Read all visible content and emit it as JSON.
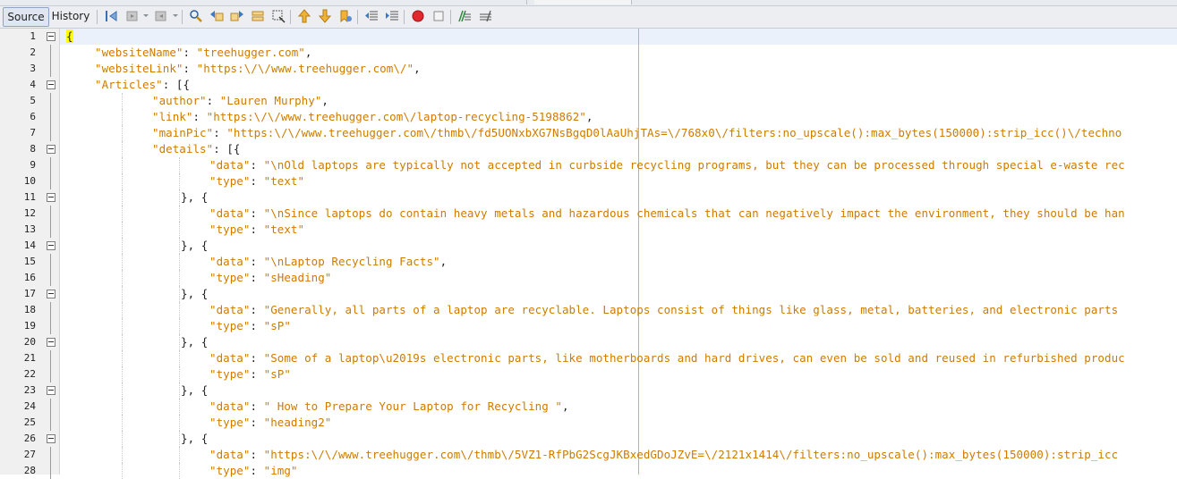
{
  "toolbar": {
    "source_label": "Source",
    "history_label": "History"
  },
  "editor": {
    "lines": [
      {
        "num": "1",
        "ind": 0,
        "segs": [
          {
            "t": "{",
            "c": "brace-hl"
          }
        ]
      },
      {
        "num": "2",
        "ind": 4,
        "segs": [
          {
            "t": "\"websiteName\"",
            "c": "k"
          },
          {
            "t": ": ",
            "c": "p"
          },
          {
            "t": "\"treehugger.com\"",
            "c": "k"
          },
          {
            "t": ",",
            "c": "p"
          }
        ]
      },
      {
        "num": "3",
        "ind": 4,
        "segs": [
          {
            "t": "\"websiteLink\"",
            "c": "k"
          },
          {
            "t": ": ",
            "c": "p"
          },
          {
            "t": "\"https:\\/\\/www.treehugger.com\\/\"",
            "c": "k"
          },
          {
            "t": ",",
            "c": "p"
          }
        ]
      },
      {
        "num": "4",
        "ind": 4,
        "segs": [
          {
            "t": "\"Articles\"",
            "c": "k"
          },
          {
            "t": ": [{",
            "c": "p"
          }
        ]
      },
      {
        "num": "5",
        "ind": 12,
        "segs": [
          {
            "t": "\"author\"",
            "c": "k"
          },
          {
            "t": ": ",
            "c": "p"
          },
          {
            "t": "\"Lauren Murphy\"",
            "c": "k"
          },
          {
            "t": ",",
            "c": "p"
          }
        ]
      },
      {
        "num": "6",
        "ind": 12,
        "segs": [
          {
            "t": "\"link\"",
            "c": "k"
          },
          {
            "t": ": ",
            "c": "p"
          },
          {
            "t": "\"https:\\/\\/www.treehugger.com\\/laptop-recycling-5198862\"",
            "c": "k"
          },
          {
            "t": ",",
            "c": "p"
          }
        ]
      },
      {
        "num": "7",
        "ind": 12,
        "segs": [
          {
            "t": "\"mainPic\"",
            "c": "k"
          },
          {
            "t": ": ",
            "c": "p"
          },
          {
            "t": "\"https:\\/\\/www.treehugger.com\\/thmb\\/fd5UONxbXG7NsBgqD0lAaUhjTAs=\\/768x0\\/filters:no_upscale():max_bytes(150000):strip_icc()\\/techno",
            "c": "k"
          }
        ]
      },
      {
        "num": "8",
        "ind": 12,
        "segs": [
          {
            "t": "\"details\"",
            "c": "k"
          },
          {
            "t": ": [{",
            "c": "p"
          }
        ]
      },
      {
        "num": "9",
        "ind": 20,
        "segs": [
          {
            "t": "\"data\"",
            "c": "k"
          },
          {
            "t": ": ",
            "c": "p"
          },
          {
            "t": "\"\\nOld laptops are typically not accepted in curbside recycling programs, but they can be processed through special e-waste rec",
            "c": "k"
          }
        ]
      },
      {
        "num": "10",
        "ind": 20,
        "segs": [
          {
            "t": "\"type\"",
            "c": "k"
          },
          {
            "t": ": ",
            "c": "p"
          },
          {
            "t": "\"text\"",
            "c": "k"
          }
        ]
      },
      {
        "num": "11",
        "ind": 16,
        "segs": [
          {
            "t": "}, {",
            "c": "p"
          }
        ]
      },
      {
        "num": "12",
        "ind": 20,
        "segs": [
          {
            "t": "\"data\"",
            "c": "k"
          },
          {
            "t": ": ",
            "c": "p"
          },
          {
            "t": "\"\\nSince laptops do contain heavy metals and hazardous chemicals that can negatively impact the environment, they should be han",
            "c": "k"
          }
        ]
      },
      {
        "num": "13",
        "ind": 20,
        "segs": [
          {
            "t": "\"type\"",
            "c": "k"
          },
          {
            "t": ": ",
            "c": "p"
          },
          {
            "t": "\"text\"",
            "c": "k"
          }
        ]
      },
      {
        "num": "14",
        "ind": 16,
        "segs": [
          {
            "t": "}, {",
            "c": "p"
          }
        ]
      },
      {
        "num": "15",
        "ind": 20,
        "segs": [
          {
            "t": "\"data\"",
            "c": "k"
          },
          {
            "t": ": ",
            "c": "p"
          },
          {
            "t": "\"\\nLaptop Recycling Facts\"",
            "c": "k"
          },
          {
            "t": ",",
            "c": "p"
          }
        ]
      },
      {
        "num": "16",
        "ind": 20,
        "segs": [
          {
            "t": "\"type\"",
            "c": "k"
          },
          {
            "t": ": ",
            "c": "p"
          },
          {
            "t": "\"sHeading\"",
            "c": "k"
          }
        ]
      },
      {
        "num": "17",
        "ind": 16,
        "segs": [
          {
            "t": "}, {",
            "c": "p"
          }
        ]
      },
      {
        "num": "18",
        "ind": 20,
        "segs": [
          {
            "t": "\"data\"",
            "c": "k"
          },
          {
            "t": ": ",
            "c": "p"
          },
          {
            "t": "\"Generally, all parts of a laptop are recyclable. Laptops consist of things like glass, metal, batteries, and electronic parts",
            "c": "k"
          }
        ]
      },
      {
        "num": "19",
        "ind": 20,
        "segs": [
          {
            "t": "\"type\"",
            "c": "k"
          },
          {
            "t": ": ",
            "c": "p"
          },
          {
            "t": "\"sP\"",
            "c": "k"
          }
        ]
      },
      {
        "num": "20",
        "ind": 16,
        "segs": [
          {
            "t": "}, {",
            "c": "p"
          }
        ]
      },
      {
        "num": "21",
        "ind": 20,
        "segs": [
          {
            "t": "\"data\"",
            "c": "k"
          },
          {
            "t": ": ",
            "c": "p"
          },
          {
            "t": "\"Some of a laptop\\u2019s electronic parts, like motherboards and hard drives, can even be sold and reused in refurbished produc",
            "c": "k"
          }
        ]
      },
      {
        "num": "22",
        "ind": 20,
        "segs": [
          {
            "t": "\"type\"",
            "c": "k"
          },
          {
            "t": ": ",
            "c": "p"
          },
          {
            "t": "\"sP\"",
            "c": "k"
          }
        ]
      },
      {
        "num": "23",
        "ind": 16,
        "segs": [
          {
            "t": "}, {",
            "c": "p"
          }
        ]
      },
      {
        "num": "24",
        "ind": 20,
        "segs": [
          {
            "t": "\"data\"",
            "c": "k"
          },
          {
            "t": ": ",
            "c": "p"
          },
          {
            "t": "\" How to Prepare Your Laptop for Recycling \"",
            "c": "k"
          },
          {
            "t": ",",
            "c": "p"
          }
        ]
      },
      {
        "num": "25",
        "ind": 20,
        "segs": [
          {
            "t": "\"type\"",
            "c": "k"
          },
          {
            "t": ": ",
            "c": "p"
          },
          {
            "t": "\"heading2\"",
            "c": "k"
          }
        ]
      },
      {
        "num": "26",
        "ind": 16,
        "segs": [
          {
            "t": "}, {",
            "c": "p"
          }
        ]
      },
      {
        "num": "27",
        "ind": 20,
        "segs": [
          {
            "t": "\"data\"",
            "c": "k"
          },
          {
            "t": ": ",
            "c": "p"
          },
          {
            "t": "\"https:\\/\\/www.treehugger.com\\/thmb\\/5VZ1-RfPbG2ScgJKBxedGDoJZvE=\\/2121x1414\\/filters:no_upscale():max_bytes(150000):strip_icc",
            "c": "k"
          }
        ]
      },
      {
        "num": "28",
        "ind": 20,
        "segs": [
          {
            "t": "\"type\"",
            "c": "k"
          },
          {
            "t": ": ",
            "c": "p"
          },
          {
            "t": "\"img\"",
            "c": "k"
          }
        ]
      }
    ],
    "fold_lines": [
      "1",
      "4",
      "8",
      "11",
      "14",
      "17",
      "20",
      "23",
      "26"
    ]
  }
}
